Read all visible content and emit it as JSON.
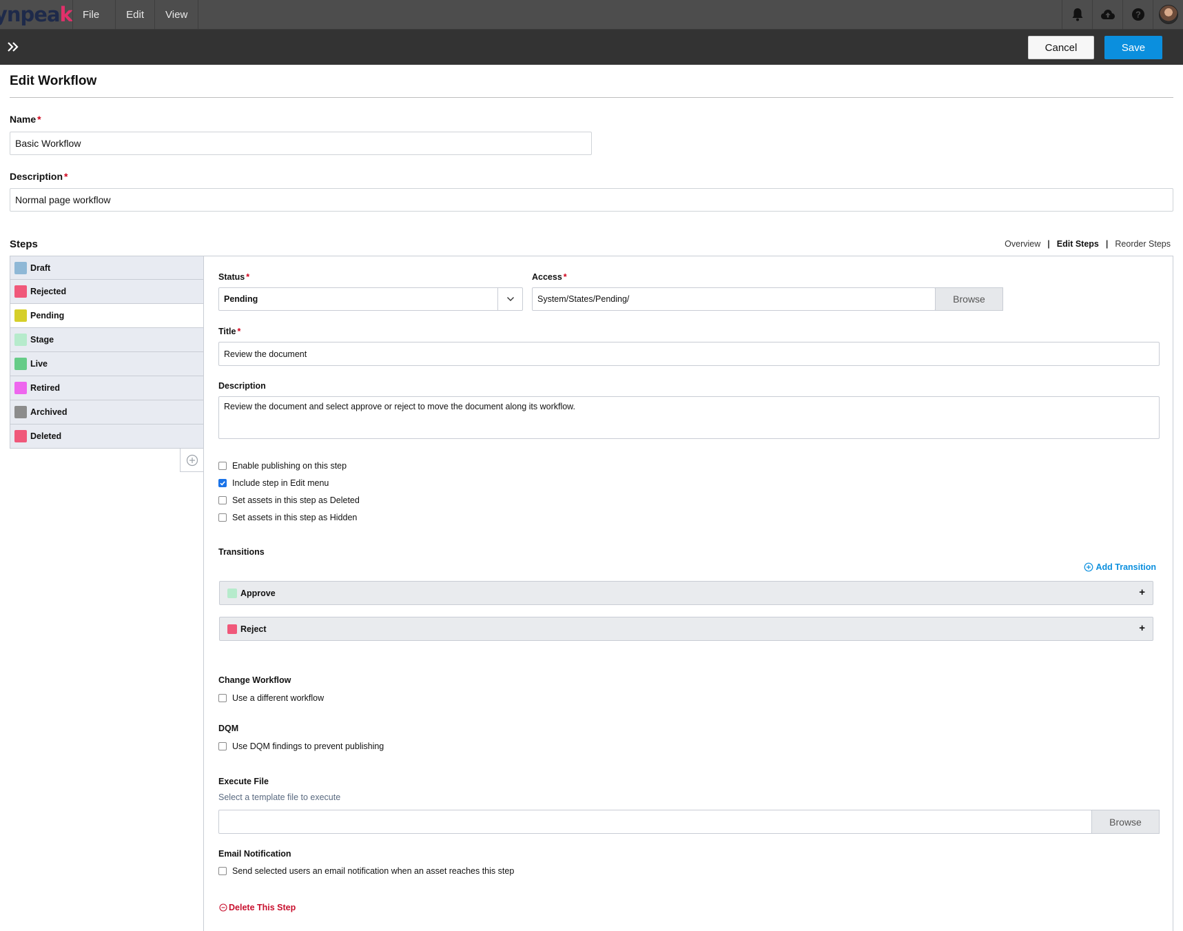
{
  "brand": {
    "logo_part1": "ynpea",
    "logo_part2": "k"
  },
  "menubar": {
    "items": [
      "File",
      "Edit",
      "View"
    ]
  },
  "topbar_icons": [
    "bell-icon",
    "cloud-upload-icon",
    "help-icon",
    "user-avatar"
  ],
  "actions": {
    "cancel_label": "Cancel",
    "save_label": "Save"
  },
  "page": {
    "title": "Edit Workflow"
  },
  "form": {
    "name_label": "Name",
    "name_value": "Basic Workflow",
    "description_label": "Description",
    "description_value": "Normal page workflow",
    "required_mark": "*"
  },
  "steps": {
    "label": "Steps",
    "view_links": [
      "Overview",
      "Edit Steps",
      "Reorder Steps"
    ],
    "active_view": "Edit Steps",
    "separator": "|",
    "items": [
      {
        "label": "Draft",
        "color": "#8fb8d6"
      },
      {
        "label": "Rejected",
        "color": "#f0587a"
      },
      {
        "label": "Pending",
        "color": "#d6cf2a",
        "active": true
      },
      {
        "label": "Stage",
        "color": "#b6ebcc"
      },
      {
        "label": "Live",
        "color": "#66cc88"
      },
      {
        "label": "Retired",
        "color": "#ee66ee"
      },
      {
        "label": "Archived",
        "color": "#8c8c8c"
      },
      {
        "label": "Deleted",
        "color": "#f0587a"
      }
    ]
  },
  "step_detail": {
    "status_label": "Status",
    "status_value": "Pending",
    "access_label": "Access",
    "access_value": "System/States/Pending/",
    "browse_label": "Browse",
    "title_label": "Title",
    "title_value": "Review the document",
    "description_label": "Description",
    "description_value": "Review the document and select approve or reject to move the document along its workflow.",
    "options": [
      {
        "label": "Enable publishing on this step",
        "checked": false
      },
      {
        "label": "Include step in Edit menu",
        "checked": true
      },
      {
        "label": "Set assets in this step as Deleted",
        "checked": false
      },
      {
        "label": "Set assets in this step as Hidden",
        "checked": false
      }
    ],
    "transitions_label": "Transitions",
    "add_transition_label": "Add Transition",
    "transitions": [
      {
        "label": "Approve",
        "color": "#b6ebcc"
      },
      {
        "label": "Reject",
        "color": "#f0587a"
      }
    ],
    "change_workflow_label": "Change Workflow",
    "change_workflow_option": "Use a different workflow",
    "dqm_label": "DQM",
    "dqm_option": "Use DQM findings to prevent publishing",
    "execute_file_label": "Execute File",
    "execute_file_hint": "Select a template file to execute",
    "execute_file_value": "",
    "execute_browse_label": "Browse",
    "email_label": "Email Notification",
    "email_option": "Send selected users an email notification when an asset reaches this step",
    "delete_label": "Delete This Step"
  },
  "colors": {
    "accent": "#0b8fde",
    "danger": "#c8102e",
    "checkbox_on": "#1a73e8"
  }
}
